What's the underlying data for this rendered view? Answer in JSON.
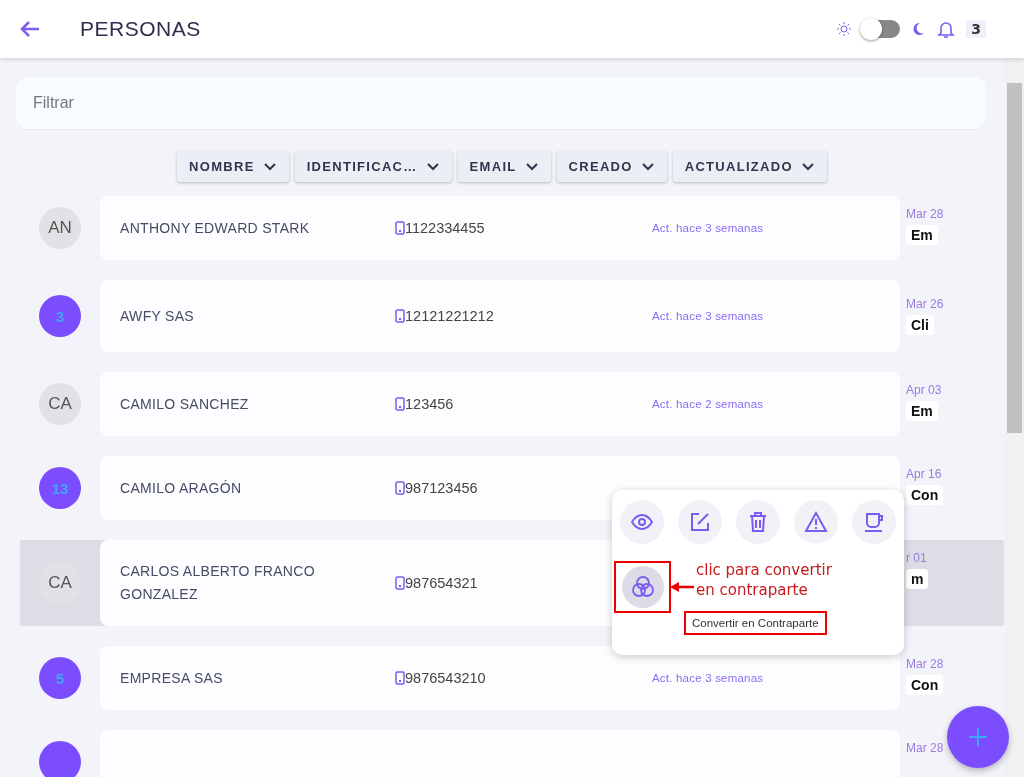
{
  "header": {
    "title": "PERSONAS",
    "theme_dark": false,
    "notifications": "3"
  },
  "filter": {
    "placeholder": "Filtrar"
  },
  "sort_columns": [
    "NOMBRE",
    "IDENTIFICAC…",
    "EMAIL",
    "CREADO",
    "ACTUALIZADO"
  ],
  "rows": [
    {
      "avatar": {
        "kind": "initials",
        "label": "AN"
      },
      "name": "ANTHONY EDWARD STARK",
      "phone": "1122334455",
      "activity": "Act. hace 3 semanas",
      "date": "Mar 28",
      "tag": "Em",
      "selected": false
    },
    {
      "avatar": {
        "kind": "count",
        "label": "3"
      },
      "name": "AWFY SAS",
      "phone": "12121221212",
      "activity": "Act. hace 3 semanas",
      "date": "Mar 26",
      "tag": "Cli",
      "selected": false
    },
    {
      "avatar": {
        "kind": "initials",
        "label": "CA"
      },
      "name": "CAMILO SANCHEZ",
      "phone": "123456",
      "activity": "Act. hace 2 semanas",
      "date": "Apr 03",
      "tag": "Em",
      "selected": false
    },
    {
      "avatar": {
        "kind": "count",
        "label": "13"
      },
      "name": "CAMILO ARAGÓN",
      "phone": "987123456",
      "date": "Apr 16",
      "tag": "Con",
      "selected": false
    },
    {
      "avatar": {
        "kind": "initials",
        "label": "CA"
      },
      "name": "CARLOS ALBERTO FRANCO GONZALEZ",
      "phone": "987654321",
      "date": "r 01",
      "tag": "m",
      "selected": true
    },
    {
      "avatar": {
        "kind": "count",
        "label": "5"
      },
      "name": "EMPRESA SAS",
      "phone": "9876543210",
      "activity": "Act. hace 3 semanas",
      "date": "Mar 28",
      "tag": "Con",
      "selected": false
    },
    {
      "avatar": {
        "kind": "count"
      },
      "date": "Mar 28",
      "selected": false
    }
  ],
  "action_menu": {
    "actions": [
      {
        "kind": "view"
      },
      {
        "kind": "edit"
      },
      {
        "kind": "delete"
      },
      {
        "kind": "warning"
      },
      {
        "kind": "coffee"
      }
    ],
    "convert": {
      "tooltip": "Convertir en Contraparte"
    }
  },
  "annotation": {
    "text": "clic para convertir en contraparte"
  }
}
